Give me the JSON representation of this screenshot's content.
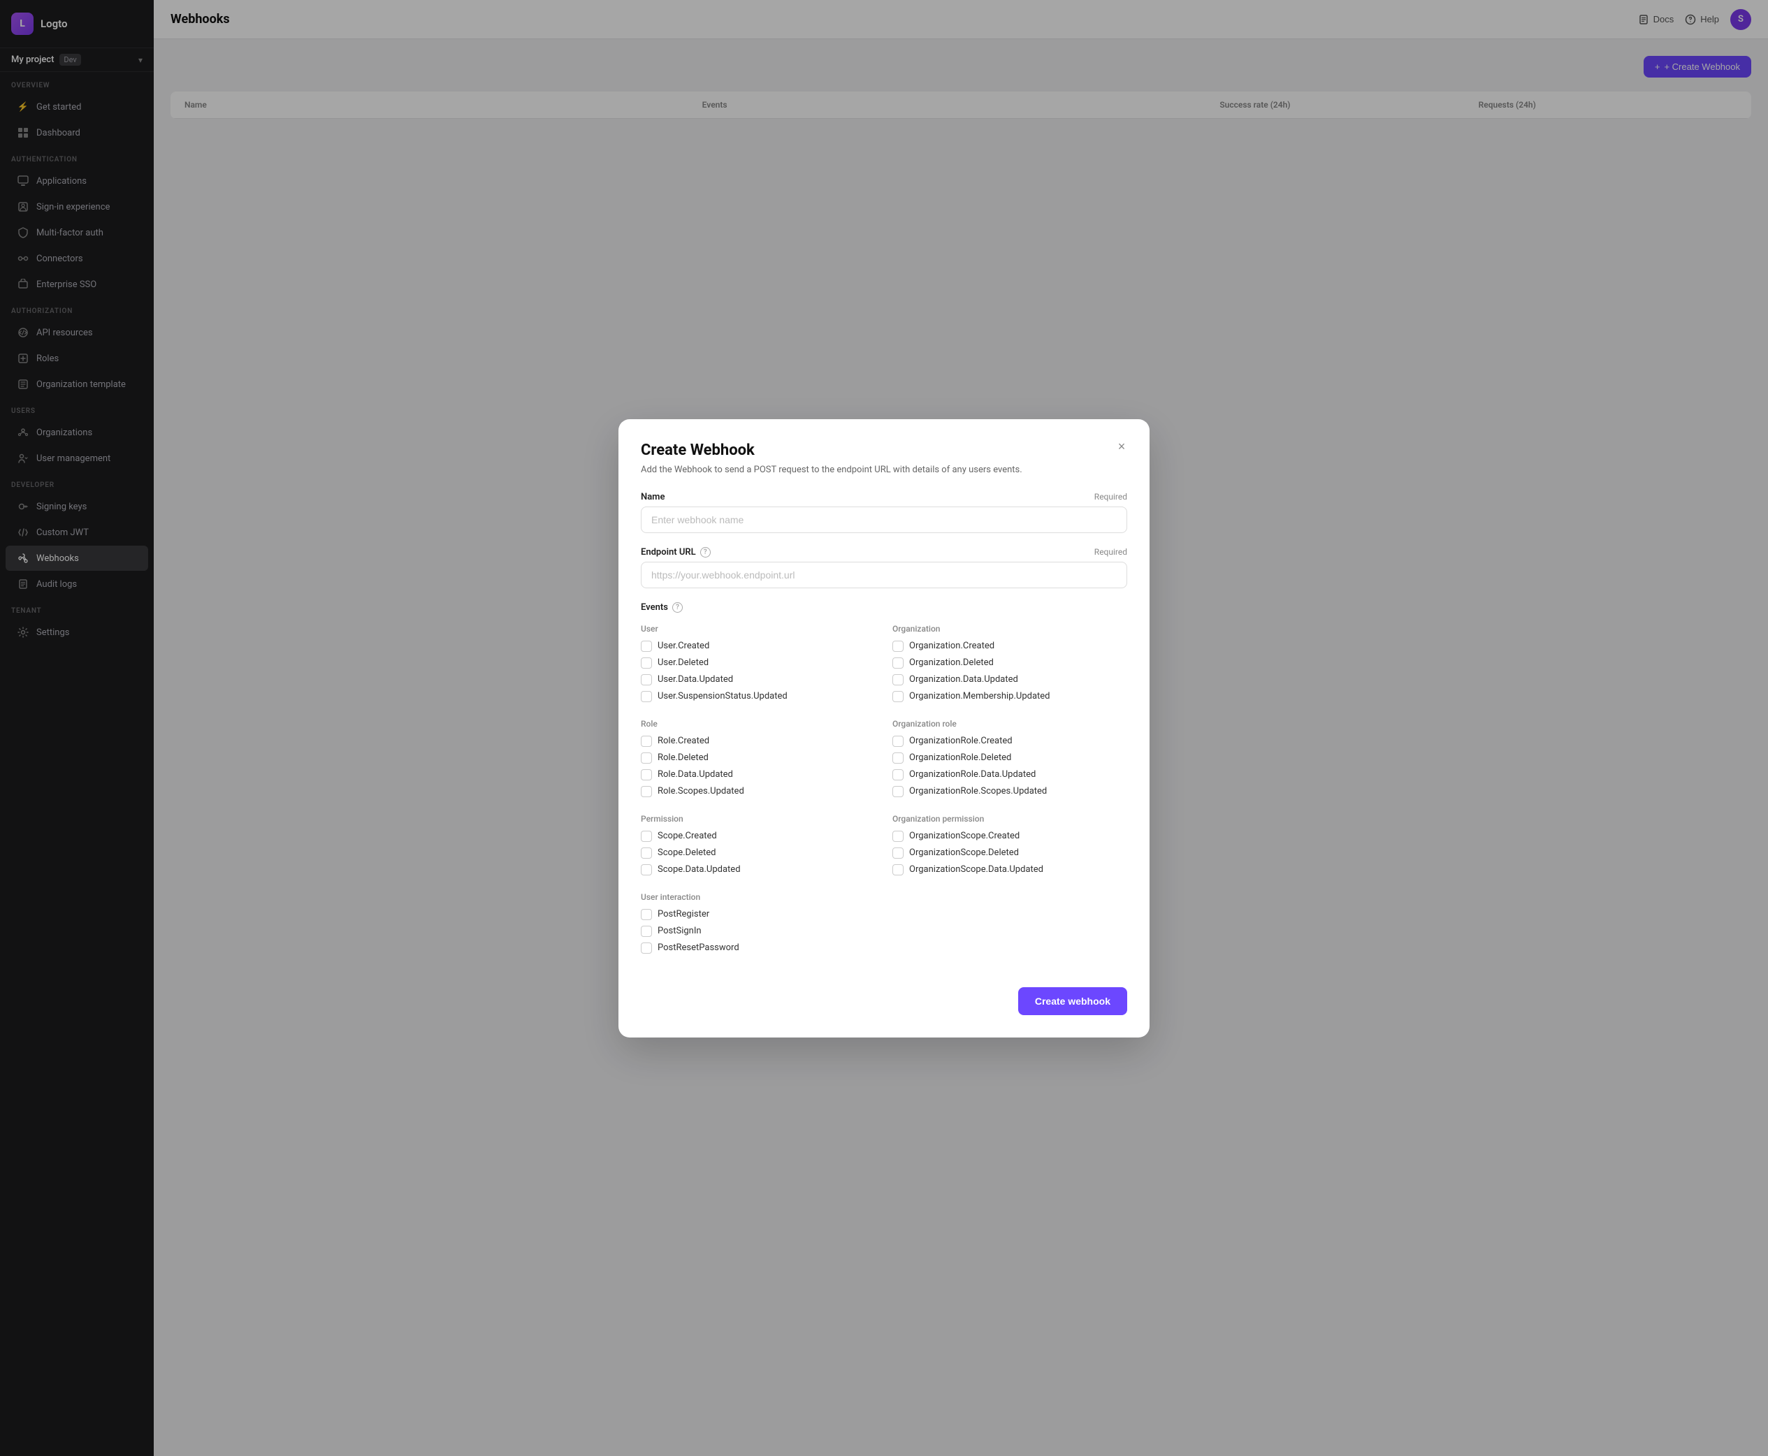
{
  "app": {
    "logo_text": "Logto",
    "project_name": "My project",
    "project_env": "Dev"
  },
  "topbar": {
    "docs_label": "Docs",
    "help_label": "Help",
    "user_initial": "S",
    "create_webhook_label": "+ Create Webhook"
  },
  "sidebar": {
    "sections": [
      {
        "label": "OVERVIEW",
        "items": [
          {
            "id": "get-started",
            "label": "Get started",
            "icon": "⚡"
          },
          {
            "id": "dashboard",
            "label": "Dashboard",
            "icon": "⊞"
          }
        ]
      },
      {
        "label": "AUTHENTICATION",
        "items": [
          {
            "id": "applications",
            "label": "Applications",
            "icon": "◻"
          },
          {
            "id": "sign-in-experience",
            "label": "Sign-in experience",
            "icon": "🪪"
          },
          {
            "id": "multi-factor-auth",
            "label": "Multi-factor auth",
            "icon": "🔒"
          },
          {
            "id": "connectors",
            "label": "Connectors",
            "icon": "🔌"
          },
          {
            "id": "enterprise-sso",
            "label": "Enterprise SSO",
            "icon": "🏢"
          }
        ]
      },
      {
        "label": "AUTHORIZATION",
        "items": [
          {
            "id": "api-resources",
            "label": "API resources",
            "icon": "⚙"
          },
          {
            "id": "roles",
            "label": "Roles",
            "icon": "◈"
          },
          {
            "id": "organization-template",
            "label": "Organization template",
            "icon": "📋"
          }
        ]
      },
      {
        "label": "USERS",
        "items": [
          {
            "id": "organizations",
            "label": "Organizations",
            "icon": "🏛"
          },
          {
            "id": "user-management",
            "label": "User management",
            "icon": "👥"
          }
        ]
      },
      {
        "label": "DEVELOPER",
        "items": [
          {
            "id": "signing-keys",
            "label": "Signing keys",
            "icon": "🔑"
          },
          {
            "id": "custom-jwt",
            "label": "Custom JWT",
            "icon": "⟨⟩"
          },
          {
            "id": "webhooks",
            "label": "Webhooks",
            "icon": "🪝",
            "active": true
          },
          {
            "id": "audit-logs",
            "label": "Audit logs",
            "icon": "📄"
          }
        ]
      },
      {
        "label": "TENANT",
        "items": [
          {
            "id": "settings",
            "label": "Settings",
            "icon": "⚙"
          }
        ]
      }
    ]
  },
  "modal": {
    "title": "Create Webhook",
    "description": "Add the Webhook to send a POST request to the endpoint URL with details of any users events.",
    "close_label": "×",
    "name_label": "Name",
    "name_required": "Required",
    "name_placeholder": "Enter webhook name",
    "url_label": "Endpoint URL",
    "url_required": "Required",
    "url_placeholder": "https://your.webhook.endpoint.url",
    "events_label": "Events",
    "submit_label": "Create webhook",
    "event_groups": [
      {
        "id": "user",
        "title": "User",
        "column": "left",
        "events": [
          {
            "id": "user-created",
            "label": "User.Created",
            "checked": false
          },
          {
            "id": "user-deleted",
            "label": "User.Deleted",
            "checked": false
          },
          {
            "id": "user-data-updated",
            "label": "User.Data.Updated",
            "checked": false
          },
          {
            "id": "user-suspension-updated",
            "label": "User.SuspensionStatus.Updated",
            "checked": false
          }
        ]
      },
      {
        "id": "organization",
        "title": "Organization",
        "column": "right",
        "events": [
          {
            "id": "org-created",
            "label": "Organization.Created",
            "checked": false
          },
          {
            "id": "org-deleted",
            "label": "Organization.Deleted",
            "checked": false
          },
          {
            "id": "org-data-updated",
            "label": "Organization.Data.Updated",
            "checked": false
          },
          {
            "id": "org-membership-updated",
            "label": "Organization.Membership.Updated",
            "checked": false
          }
        ]
      },
      {
        "id": "role",
        "title": "Role",
        "column": "left",
        "events": [
          {
            "id": "role-created",
            "label": "Role.Created",
            "checked": false
          },
          {
            "id": "role-deleted",
            "label": "Role.Deleted",
            "checked": false
          },
          {
            "id": "role-data-updated",
            "label": "Role.Data.Updated",
            "checked": false
          },
          {
            "id": "role-scopes-updated",
            "label": "Role.Scopes.Updated",
            "checked": false
          }
        ]
      },
      {
        "id": "organization-role",
        "title": "Organization role",
        "column": "right",
        "events": [
          {
            "id": "orgrole-created",
            "label": "OrganizationRole.Created",
            "checked": false
          },
          {
            "id": "orgrole-deleted",
            "label": "OrganizationRole.Deleted",
            "checked": false
          },
          {
            "id": "orgrole-data-updated",
            "label": "OrganizationRole.Data.Updated",
            "checked": false
          },
          {
            "id": "orgrole-scopes-updated",
            "label": "OrganizationRole.Scopes.Updated",
            "checked": false
          }
        ]
      },
      {
        "id": "permission",
        "title": "Permission",
        "column": "left",
        "events": [
          {
            "id": "scope-created",
            "label": "Scope.Created",
            "checked": false
          },
          {
            "id": "scope-deleted",
            "label": "Scope.Deleted",
            "checked": false
          },
          {
            "id": "scope-data-updated",
            "label": "Scope.Data.Updated",
            "checked": false
          }
        ]
      },
      {
        "id": "organization-permission",
        "title": "Organization permission",
        "column": "right",
        "events": [
          {
            "id": "orgscope-created",
            "label": "OrganizationScope.Created",
            "checked": false
          },
          {
            "id": "orgscope-deleted",
            "label": "OrganizationScope.Deleted",
            "checked": false
          },
          {
            "id": "orgscope-data-updated",
            "label": "OrganizationScope.Data.Updated",
            "checked": false
          }
        ]
      },
      {
        "id": "user-interaction",
        "title": "User interaction",
        "column": "full",
        "events": [
          {
            "id": "post-register",
            "label": "PostRegister",
            "checked": false
          },
          {
            "id": "post-signin",
            "label": "PostSignIn",
            "checked": false
          },
          {
            "id": "post-reset-password",
            "label": "PostResetPassword",
            "checked": false
          }
        ]
      }
    ]
  },
  "table": {
    "columns": [
      "Name",
      "Events",
      "Success rate (24h)",
      "Requests (24h)"
    ]
  }
}
